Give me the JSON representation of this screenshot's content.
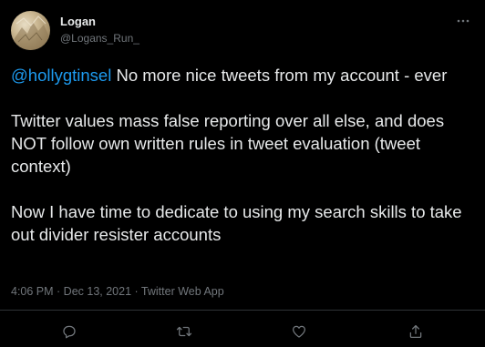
{
  "user": {
    "display_name": "Logan",
    "handle": "@Logans_Run_"
  },
  "more_icon": "more-horizontal-icon",
  "tweet": {
    "mention": "@hollygtinsel",
    "paragraphs": [
      " No more nice tweets from my account - ever",
      "Twitter values mass false reporting over all else, and does NOT follow own written rules in tweet evaluation (tweet context)",
      "Now I have time to dedicate to using my search skills to take out divider resister accounts"
    ]
  },
  "meta": {
    "time": "4:06 PM",
    "separator": " · ",
    "date": "Dec 13, 2021",
    "source": "Twitter Web App"
  },
  "actions": [
    {
      "name": "reply",
      "icon": "reply-icon"
    },
    {
      "name": "retweet",
      "icon": "retweet-icon"
    },
    {
      "name": "like",
      "icon": "heart-icon"
    },
    {
      "name": "share",
      "icon": "share-icon"
    }
  ],
  "colors": {
    "background": "#000000",
    "text": "#e7e9ea",
    "secondary": "#71767b",
    "accent": "#1d9bf0",
    "divider": "#2f3336"
  }
}
